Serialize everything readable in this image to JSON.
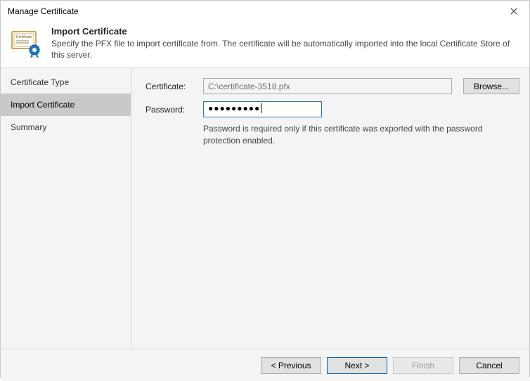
{
  "window": {
    "title": "Manage Certificate"
  },
  "header": {
    "title": "Import Certificate",
    "description": "Specify the PFX file to import certificate from. The certificate will be automatically imported into the local Certificate Store of this server."
  },
  "sidebar": {
    "steps": [
      {
        "label": "Certificate Type",
        "active": false
      },
      {
        "label": "Import Certificate",
        "active": true
      },
      {
        "label": "Summary",
        "active": false
      }
    ]
  },
  "form": {
    "certificate_label": "Certificate:",
    "certificate_value": "C:\\certificate-3518.pfx",
    "browse_label": "Browse...",
    "password_label": "Password:",
    "password_mask": "●●●●●●●●●",
    "password_hint": "Password is required only if this certificate was exported with the password protection enabled."
  },
  "footer": {
    "previous": "< Previous",
    "next": "Next >",
    "finish": "Finish",
    "cancel": "Cancel"
  },
  "icons": {
    "certificate": "certificate-icon",
    "close": "close-icon"
  }
}
